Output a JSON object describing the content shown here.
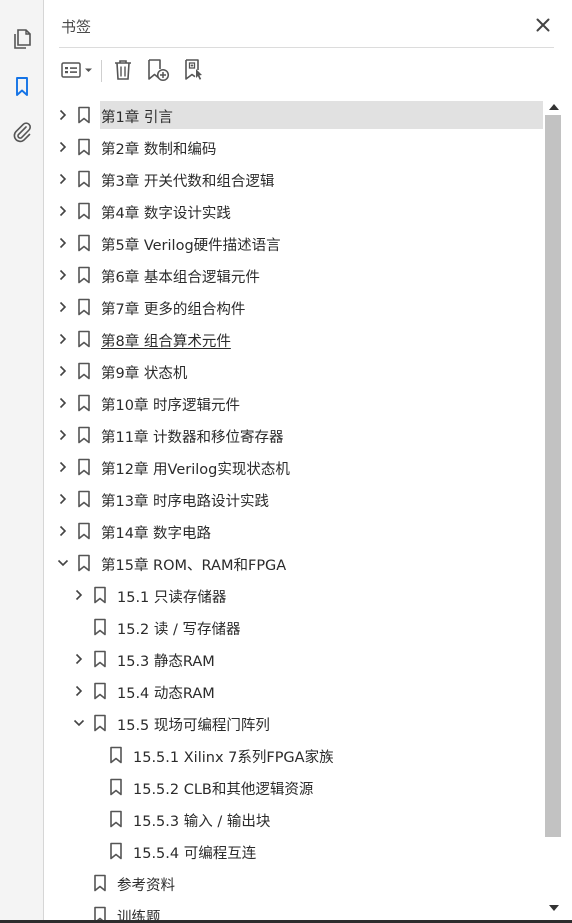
{
  "panel": {
    "title": "书签"
  },
  "colors": {
    "accent": "#1473e6",
    "selection": "#e1e1e1",
    "scroll_thumb": "#c2c2c2"
  },
  "leftbar": {
    "items": [
      {
        "icon": "pages-icon",
        "active": false
      },
      {
        "icon": "bookmark-icon",
        "active": true
      },
      {
        "icon": "attachment-icon",
        "active": false
      }
    ]
  },
  "toolbar": {
    "items": [
      {
        "icon": "options-menu-icon"
      },
      {
        "icon": "delete-icon"
      },
      {
        "icon": "new-bookmark-icon"
      },
      {
        "icon": "add-bookmark-from-structure-icon"
      }
    ]
  },
  "bookmarks": [
    {
      "label": "第1章 引言",
      "level": 0,
      "expander": "collapsed",
      "selected": true,
      "underline": false
    },
    {
      "label": "第2章 数制和编码",
      "level": 0,
      "expander": "collapsed",
      "selected": false,
      "underline": false
    },
    {
      "label": "第3章 开关代数和组合逻辑",
      "level": 0,
      "expander": "collapsed",
      "selected": false,
      "underline": false
    },
    {
      "label": "第4章 数字设计实践",
      "level": 0,
      "expander": "collapsed",
      "selected": false,
      "underline": false
    },
    {
      "label": "第5章 Verilog硬件描述语言",
      "level": 0,
      "expander": "collapsed",
      "selected": false,
      "underline": false
    },
    {
      "label": "第6章 基本组合逻辑元件",
      "level": 0,
      "expander": "collapsed",
      "selected": false,
      "underline": false
    },
    {
      "label": "第7章 更多的组合构件",
      "level": 0,
      "expander": "collapsed",
      "selected": false,
      "underline": false
    },
    {
      "label": "第8章 组合算术元件",
      "level": 0,
      "expander": "collapsed",
      "selected": false,
      "underline": true
    },
    {
      "label": "第9章 状态机",
      "level": 0,
      "expander": "collapsed",
      "selected": false,
      "underline": false
    },
    {
      "label": "第10章 时序逻辑元件",
      "level": 0,
      "expander": "collapsed",
      "selected": false,
      "underline": false
    },
    {
      "label": "第11章 计数器和移位寄存器",
      "level": 0,
      "expander": "collapsed",
      "selected": false,
      "underline": false
    },
    {
      "label": "第12章 用Verilog实现状态机",
      "level": 0,
      "expander": "collapsed",
      "selected": false,
      "underline": false
    },
    {
      "label": "第13章 时序电路设计实践",
      "level": 0,
      "expander": "collapsed",
      "selected": false,
      "underline": false
    },
    {
      "label": "第14章 数字电路",
      "level": 0,
      "expander": "collapsed",
      "selected": false,
      "underline": false
    },
    {
      "label": "第15章 ROM、RAM和FPGA",
      "level": 0,
      "expander": "expanded",
      "selected": false,
      "underline": false
    },
    {
      "label": "15.1 只读存储器",
      "level": 1,
      "expander": "collapsed",
      "selected": false,
      "underline": false
    },
    {
      "label": "15.2 读 / 写存储器",
      "level": 1,
      "expander": "none",
      "selected": false,
      "underline": false
    },
    {
      "label": "15.3 静态RAM",
      "level": 1,
      "expander": "collapsed",
      "selected": false,
      "underline": false
    },
    {
      "label": "15.4 动态RAM",
      "level": 1,
      "expander": "collapsed",
      "selected": false,
      "underline": false
    },
    {
      "label": "15.5 现场可编程门阵列",
      "level": 1,
      "expander": "expanded",
      "selected": false,
      "underline": false
    },
    {
      "label": "15.5.1 Xilinx 7系列FPGA家族",
      "level": 2,
      "expander": "none",
      "selected": false,
      "underline": false
    },
    {
      "label": "15.5.2 CLB和其他逻辑资源",
      "level": 2,
      "expander": "none",
      "selected": false,
      "underline": false
    },
    {
      "label": "15.5.3 输入 / 输出块",
      "level": 2,
      "expander": "none",
      "selected": false,
      "underline": false
    },
    {
      "label": "15.5.4 可编程互连",
      "level": 2,
      "expander": "none",
      "selected": false,
      "underline": false
    },
    {
      "label": "参考资料",
      "level": 1,
      "expander": "none",
      "selected": false,
      "underline": false
    },
    {
      "label": "训练题",
      "level": 1,
      "expander": "none",
      "selected": false,
      "underline": false
    }
  ]
}
